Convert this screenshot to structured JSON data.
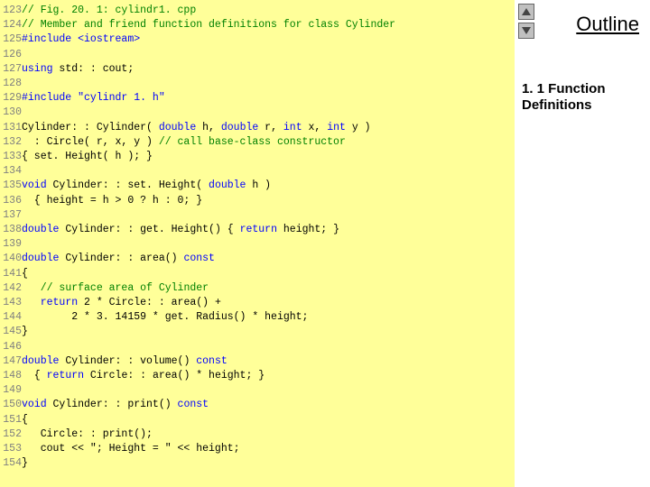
{
  "outline": {
    "title": "Outline",
    "section": "1. 1 Function Definitions"
  },
  "code": [
    {
      "n": "123",
      "t": "// Fig. 20. 1: cylindr1. cpp",
      "cls": "cm"
    },
    {
      "n": "124",
      "t": "// Member and friend function definitions for class Cylinder",
      "cls": "cm"
    },
    {
      "n": "125",
      "t": "#include <iostream>",
      "cls": "kw"
    },
    {
      "n": "126",
      "t": "",
      "cls": "pl"
    },
    {
      "n": "127",
      "segs": [
        {
          "t": "using",
          "cls": "kw"
        },
        {
          "t": " std: : cout;",
          "cls": "pl"
        }
      ]
    },
    {
      "n": "128",
      "t": "",
      "cls": "pl"
    },
    {
      "n": "129",
      "t": "#include \"cylindr 1. h\"",
      "cls": "kw"
    },
    {
      "n": "130",
      "t": "",
      "cls": "pl"
    },
    {
      "n": "131",
      "segs": [
        {
          "t": "Cylinder: : Cylinder( ",
          "cls": "pl"
        },
        {
          "t": "double",
          "cls": "kw"
        },
        {
          "t": " h, ",
          "cls": "pl"
        },
        {
          "t": "double",
          "cls": "kw"
        },
        {
          "t": " r, ",
          "cls": "pl"
        },
        {
          "t": "int",
          "cls": "kw"
        },
        {
          "t": " x, ",
          "cls": "pl"
        },
        {
          "t": "int",
          "cls": "kw"
        },
        {
          "t": " y )",
          "cls": "pl"
        }
      ]
    },
    {
      "n": "132",
      "segs": [
        {
          "t": "  : Circle( r, x, y ) ",
          "cls": "pl"
        },
        {
          "t": "// call base-class constructor",
          "cls": "cm"
        }
      ]
    },
    {
      "n": "133",
      "t": "{ set. Height( h ); }",
      "cls": "pl"
    },
    {
      "n": "134",
      "t": "",
      "cls": "pl"
    },
    {
      "n": "135",
      "segs": [
        {
          "t": "void",
          "cls": "kw"
        },
        {
          "t": " Cylinder: : set. Height( ",
          "cls": "pl"
        },
        {
          "t": "double",
          "cls": "kw"
        },
        {
          "t": " h )",
          "cls": "pl"
        }
      ]
    },
    {
      "n": "136",
      "t": "  { height = h > 0 ? h : 0; }",
      "cls": "pl"
    },
    {
      "n": "137",
      "t": "",
      "cls": "pl"
    },
    {
      "n": "138",
      "segs": [
        {
          "t": "double",
          "cls": "kw"
        },
        {
          "t": " Cylinder: : get. Height() { ",
          "cls": "pl"
        },
        {
          "t": "return",
          "cls": "kw"
        },
        {
          "t": " height; }",
          "cls": "pl"
        }
      ]
    },
    {
      "n": "139",
      "t": "",
      "cls": "pl"
    },
    {
      "n": "140",
      "segs": [
        {
          "t": "double",
          "cls": "kw"
        },
        {
          "t": " Cylinder: : area() ",
          "cls": "pl"
        },
        {
          "t": "const",
          "cls": "kw"
        }
      ]
    },
    {
      "n": "141",
      "t": "{",
      "cls": "pl"
    },
    {
      "n": "142",
      "segs": [
        {
          "t": "   ",
          "cls": "pl"
        },
        {
          "t": "// surface area of Cylinder",
          "cls": "cm"
        }
      ]
    },
    {
      "n": "143",
      "segs": [
        {
          "t": "   ",
          "cls": "pl"
        },
        {
          "t": "return",
          "cls": "kw"
        },
        {
          "t": " 2 * Circle: : area() +",
          "cls": "pl"
        }
      ]
    },
    {
      "n": "144",
      "t": "        2 * 3. 14159 * get. Radius() * height;",
      "cls": "pl"
    },
    {
      "n": "145",
      "t": "}",
      "cls": "pl"
    },
    {
      "n": "146",
      "t": "",
      "cls": "pl"
    },
    {
      "n": "147",
      "segs": [
        {
          "t": "double",
          "cls": "kw"
        },
        {
          "t": " Cylinder: : volume() ",
          "cls": "pl"
        },
        {
          "t": "const",
          "cls": "kw"
        }
      ]
    },
    {
      "n": "148",
      "segs": [
        {
          "t": "  { ",
          "cls": "pl"
        },
        {
          "t": "return",
          "cls": "kw"
        },
        {
          "t": " Circle: : area() * height; }",
          "cls": "pl"
        }
      ]
    },
    {
      "n": "149",
      "t": "",
      "cls": "pl"
    },
    {
      "n": "150",
      "segs": [
        {
          "t": "void",
          "cls": "kw"
        },
        {
          "t": " Cylinder: : print() ",
          "cls": "pl"
        },
        {
          "t": "const",
          "cls": "kw"
        }
      ]
    },
    {
      "n": "151",
      "t": "{",
      "cls": "pl"
    },
    {
      "n": "152",
      "t": "   Circle: : print();",
      "cls": "pl"
    },
    {
      "n": "153",
      "t": "   cout << \"; Height = \" << height;",
      "cls": "pl"
    },
    {
      "n": "154",
      "t": "}",
      "cls": "pl"
    }
  ]
}
